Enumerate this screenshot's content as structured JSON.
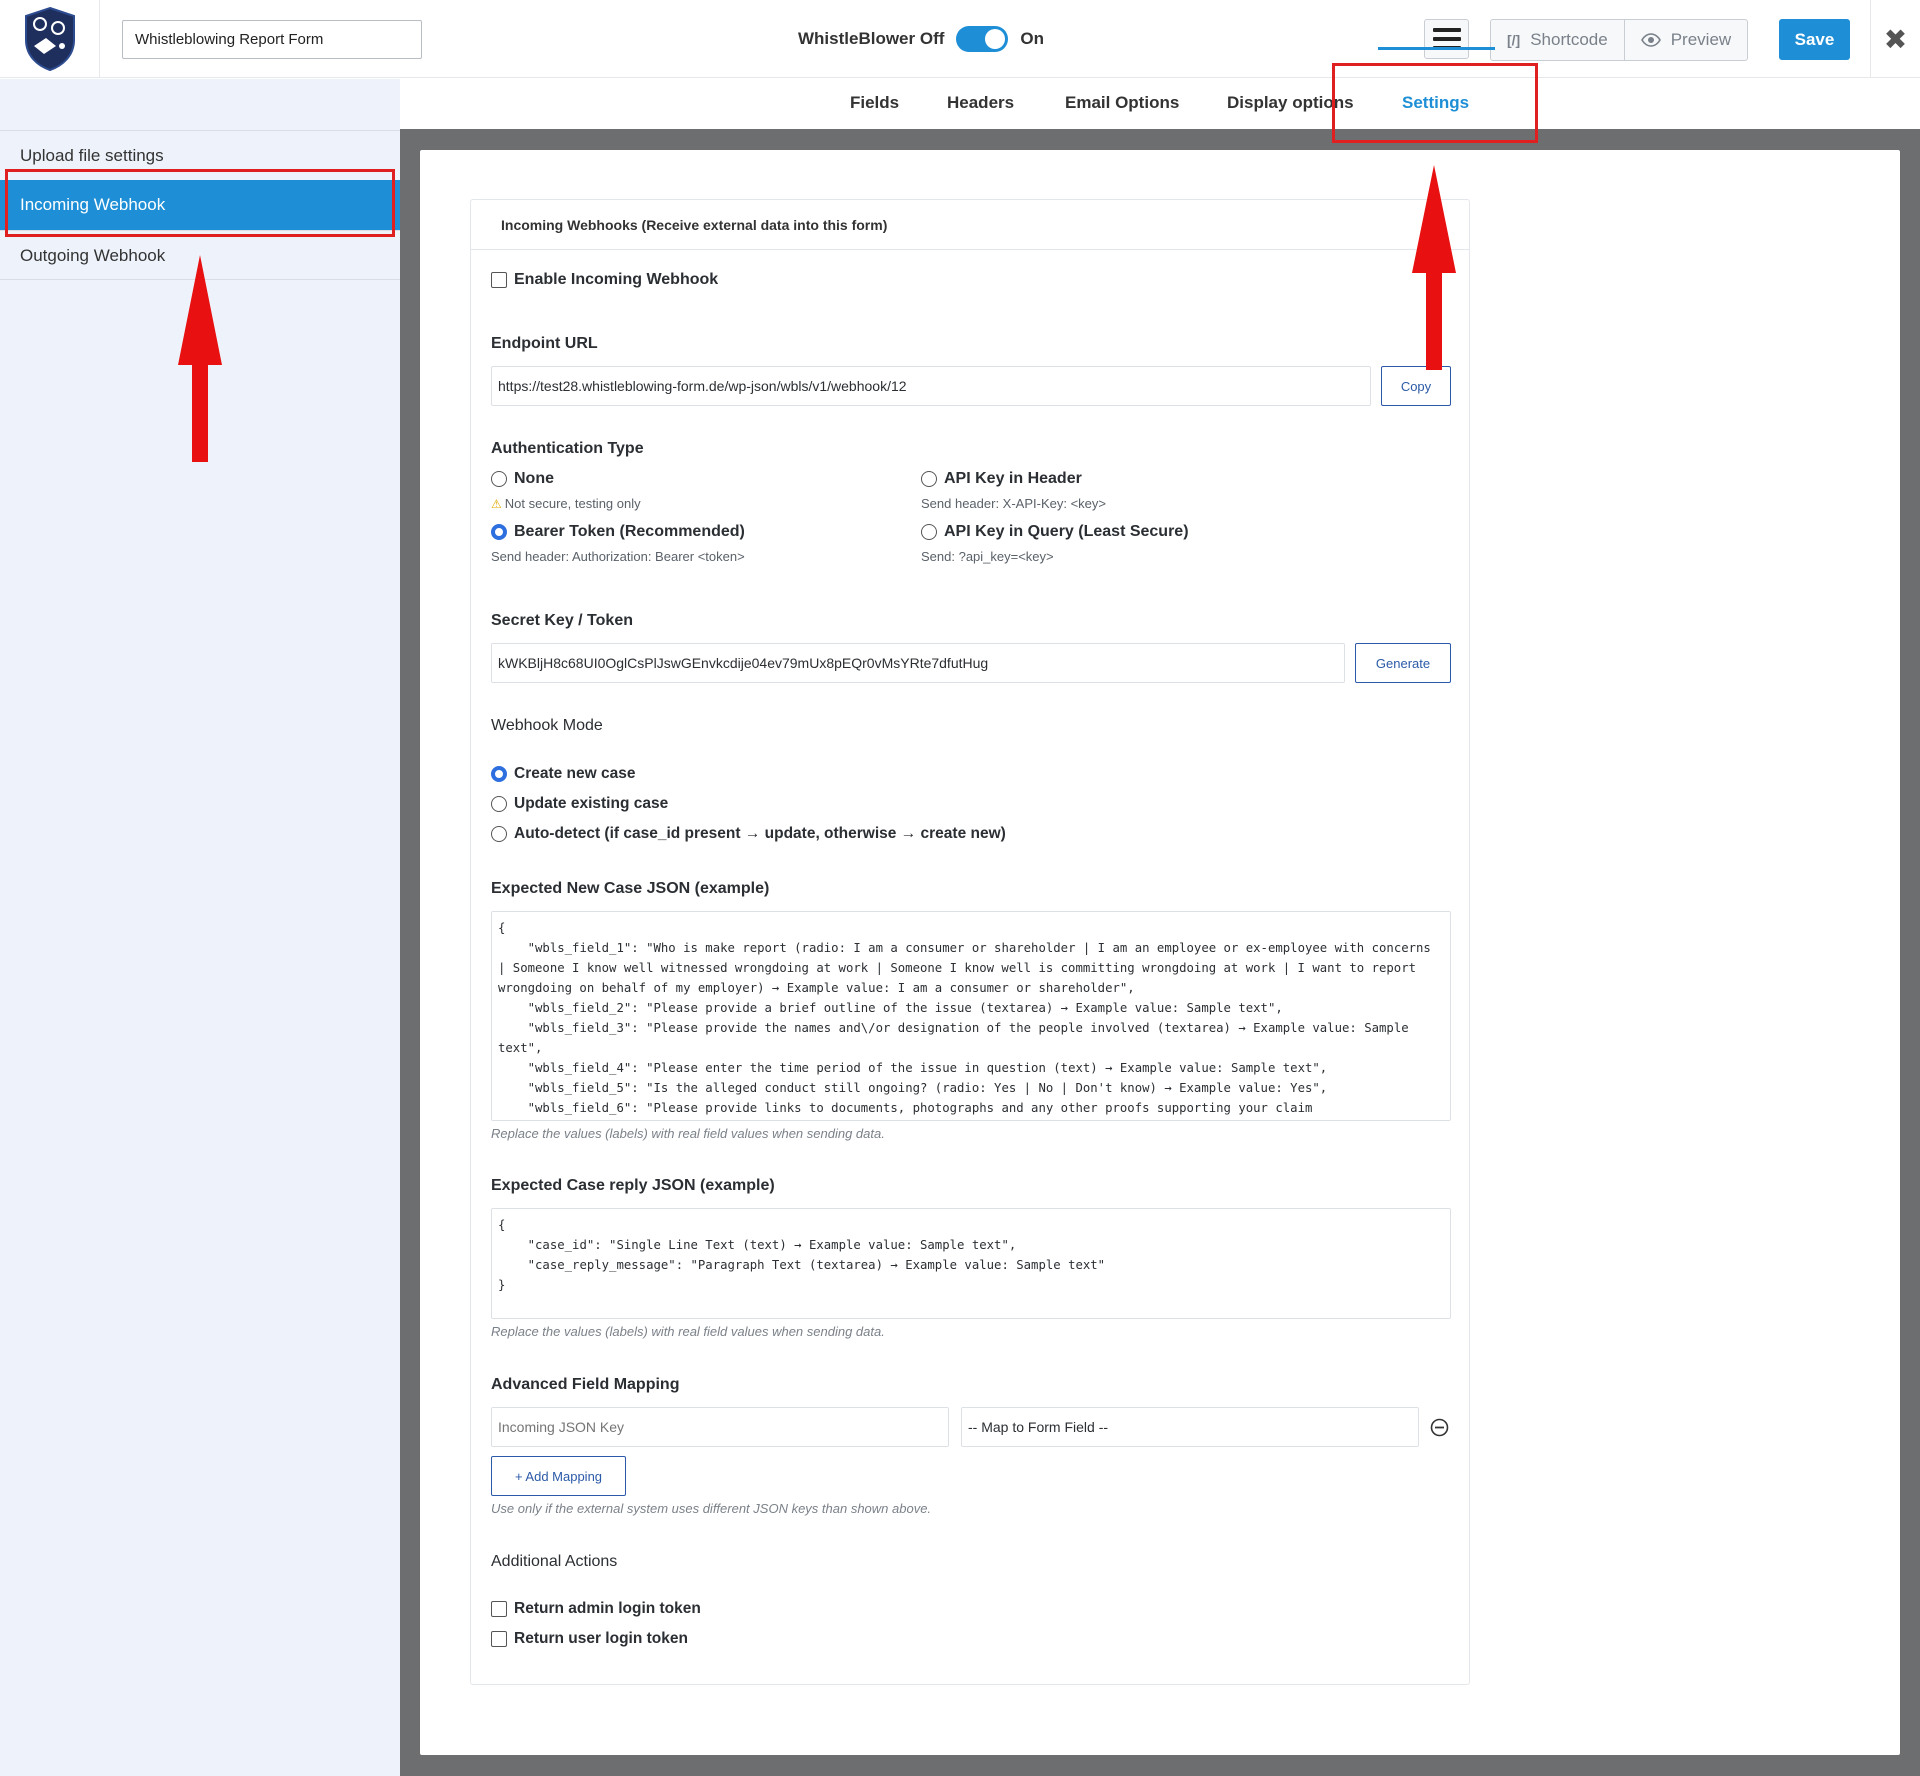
{
  "header": {
    "form_title": "Whistleblowing Report Form",
    "toggle_off_label": "WhistleBlower Off",
    "toggle_on_label": "On",
    "shortcode_icon": "[/]",
    "shortcode_label": "Shortcode",
    "preview_label": "Preview",
    "save_label": "Save",
    "close_glyph": "✖"
  },
  "sidebar": {
    "items": [
      {
        "label": "Upload file settings"
      },
      {
        "label": "Incoming Webhook"
      },
      {
        "label": "Outgoing Webhook"
      }
    ],
    "active": "Incoming Webhook"
  },
  "tabs": {
    "items": [
      {
        "label": "Fields"
      },
      {
        "label": "Headers"
      },
      {
        "label": "Email Options"
      },
      {
        "label": "Display options"
      },
      {
        "label": "Settings"
      }
    ],
    "active": "Settings"
  },
  "panel": {
    "title": "Incoming Webhooks (Receive external data into this form)",
    "enable_label": "Enable Incoming Webhook",
    "endpoint_label": "Endpoint URL",
    "endpoint_value": "https://test28.whistleblowing-form.de/wp-json/wbls/v1/webhook/12",
    "copy_label": "Copy",
    "auth_label": "Authentication Type",
    "auth_options": [
      {
        "label": "None",
        "desc": "Not secure, testing only",
        "selected": false
      },
      {
        "label": "API Key in Header",
        "desc": "Send header: X-API-Key: <key>",
        "selected": false
      },
      {
        "label": "Bearer Token (Recommended)",
        "desc": "Send header: Authorization: Bearer <token>",
        "selected": true
      },
      {
        "label": "API Key in Query (Least Secure)",
        "desc": "Send: ?api_key=<key>",
        "selected": false
      }
    ],
    "warning_glyph": "⚠",
    "secret_label": "Secret Key / Token",
    "secret_value": "kWKBljH8c68UI0OglCsPlJswGEnvkcdije04ev79mUx8pEQr0vMsYRte7dfutHug",
    "generate_label": "Generate",
    "mode_label": "Webhook Mode",
    "mode_options": [
      {
        "label": "Create new case",
        "selected": true
      },
      {
        "label": "Update existing case",
        "selected": false
      },
      {
        "label": "Auto-detect (if case_id present → update, otherwise → create new)",
        "selected": false
      }
    ],
    "new_case_label": "Expected New Case JSON (example)",
    "new_case_json": "{\n    \"wbls_field_1\": \"Who is make report (radio: I am a consumer or shareholder | I am an employee or ex-employee with concerns | Someone I know well witnessed wrongdoing at work | Someone I know well is committing wrongdoing at work | I want to report wrongdoing on behalf of my employer) → Example value: I am a consumer or shareholder\",\n    \"wbls_field_2\": \"Please provide a brief outline of the issue (textarea) → Example value: Sample text\",\n    \"wbls_field_3\": \"Please provide the names and\\/or designation of the people involved (textarea) → Example value: Sample text\",\n    \"wbls_field_4\": \"Please enter the time period of the issue in question (text) → Example value: Sample text\",\n    \"wbls_field_5\": \"Is the alleged conduct still ongoing? (radio: Yes | No | Don't know) → Example value: Yes\",\n    \"wbls_field_6\": \"Please provide links to documents, photographs and any other proofs supporting your claim",
    "new_case_note": "Replace the values (labels) with real field values when sending data.",
    "reply_label": "Expected Case reply JSON (example)",
    "reply_json": "{\n    \"case_id\": \"Single Line Text (text) → Example value: Sample text\",\n    \"case_reply_message\": \"Paragraph Text (textarea) → Example value: Sample text\"\n}",
    "reply_note": "Replace the values (labels) with real field values when sending data.",
    "mapping_label": "Advanced Field Mapping",
    "mapping_key_placeholder": "Incoming JSON Key",
    "mapping_select_value": "-- Map to Form Field --",
    "add_mapping_label": "+ Add Mapping",
    "mapping_note": "Use only if the external system uses different JSON keys than shown above.",
    "additional_label": "Additional Actions",
    "additional_options": [
      {
        "label": "Return admin login token"
      },
      {
        "label": "Return user login token"
      }
    ]
  },
  "colors": {
    "accent": "#1e8fd6",
    "annotation_red": "#e02020",
    "radio_selected": "#2e6fe0",
    "button_outline": "#2c5aa8"
  }
}
